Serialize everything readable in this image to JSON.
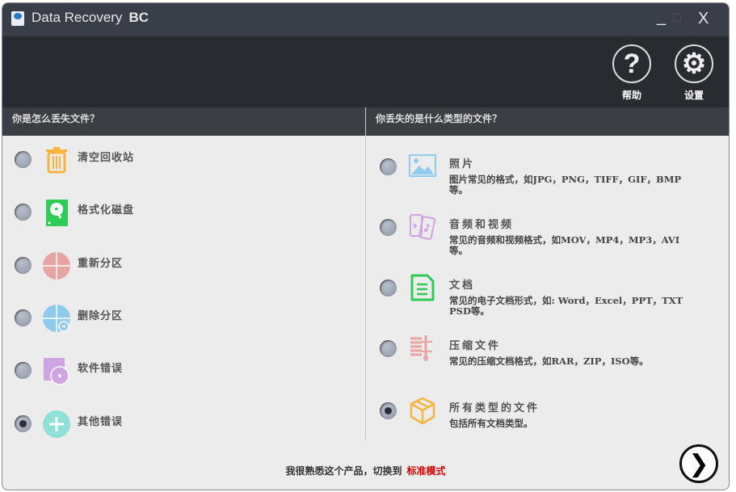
{
  "window": {
    "title": "Data Recovery",
    "title_suffix": "BC",
    "minimize": "_",
    "maximize": "□",
    "close": "X"
  },
  "toolbar": {
    "help_label": "帮助",
    "settings_label": "设置",
    "help_glyph": "?",
    "settings_glyph": "⚙"
  },
  "left": {
    "heading": "你是怎么丢失文件？",
    "items": [
      {
        "label": "清空回收站",
        "icon": "trash-icon",
        "color": "#f9b43c",
        "selected": false
      },
      {
        "label": "格式化磁盘",
        "icon": "hard-disk-icon",
        "color": "#2ecc55",
        "selected": false
      },
      {
        "label": "重新分区",
        "icon": "partition-icon",
        "color": "#e8a3a3",
        "selected": false
      },
      {
        "label": "删除分区",
        "icon": "delete-partition-icon",
        "color": "#8ecbec",
        "selected": false
      },
      {
        "label": "软件错误",
        "icon": "software-error-icon",
        "color": "#cea4e3",
        "selected": false
      },
      {
        "label": "其他错误",
        "icon": "plus-icon",
        "color": "#8fe0d6",
        "selected": true
      }
    ]
  },
  "right": {
    "heading": "你丢失的是什么类型的文件？",
    "items": [
      {
        "title": "照片",
        "desc": "图片常见的格式，如JPG，PNG，TIFF，GIF，BMP等。",
        "icon": "image-icon",
        "color": "#8ecbec",
        "selected": false
      },
      {
        "title": "音频和视频",
        "desc": "常见的音频和视频格式，如MOV，MP4，MP3，AVI等。",
        "icon": "media-icon",
        "color": "#cea4e3",
        "selected": false
      },
      {
        "title": "文档",
        "desc": "常见的电子文档形式，如: Word，Excel，PPT，TXT PSD等。",
        "icon": "document-icon",
        "color": "#2ecc55",
        "selected": false
      },
      {
        "title": "压缩文件",
        "desc": "常见的压缩文档格式，如RAR，ZIP，ISO等。",
        "icon": "archive-icon",
        "color": "#e8a3a3",
        "selected": false
      },
      {
        "title": "所有类型的文件",
        "desc": "包括所有文档类型。",
        "icon": "box-icon",
        "color": "#f9b43c",
        "selected": true
      }
    ]
  },
  "footer": {
    "text": "我很熟悉这个产品，切换到",
    "link": "标准模式",
    "next_glyph": "❯"
  }
}
